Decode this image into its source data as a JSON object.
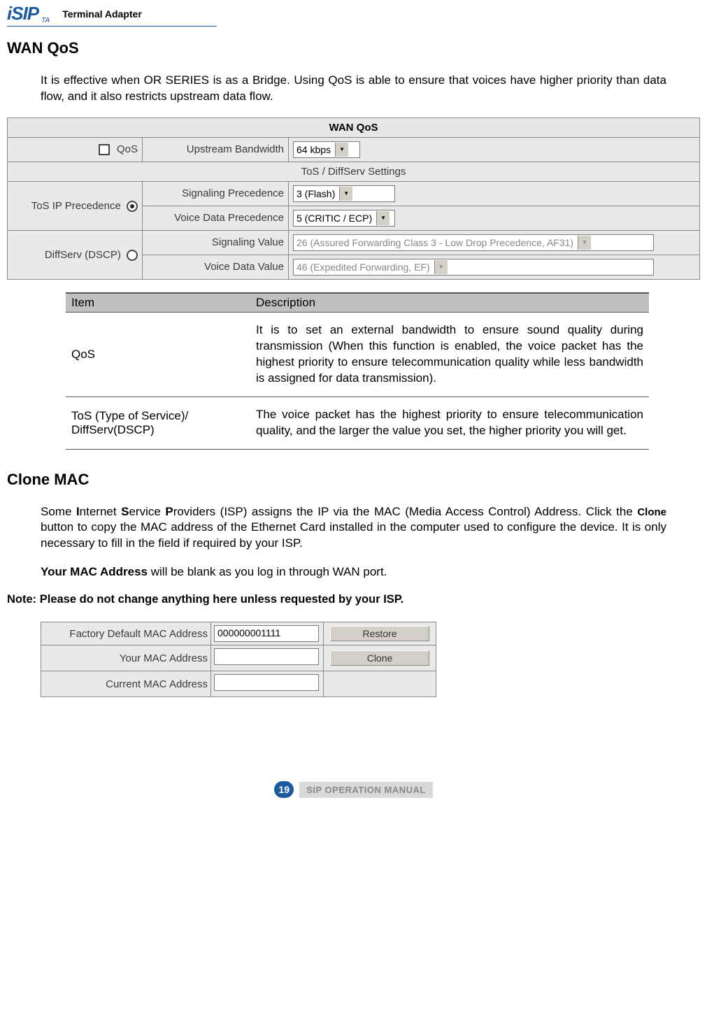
{
  "logo": {
    "ta": "TA",
    "product": "Terminal Adapter"
  },
  "sections": {
    "wan_qos": {
      "heading": "WAN QoS",
      "intro": "It is effective when OR SERIES is as a Bridge. Using QoS is able to ensure that voices have higher priority than data flow, and it also restricts upstream data flow."
    },
    "clone_mac": {
      "heading": "Clone MAC",
      "p1a": "Some ",
      "p1b": "nternet ",
      "p1c": "ervice ",
      "p1d": "roviders (ISP) assigns the IP via the MAC (Media Access Control) Address. Click the ",
      "p1e": " button to copy the MAC address of the Ethernet Card installed in the computer used to configure the device. It is only necessary to fill in the field if required by your ISP.",
      "p2a": "Your MAC Address",
      "p2b": " will be blank as you log in through WAN port.",
      "clone_word": "Clone",
      "i": "I",
      "s": "S",
      "p": "P"
    }
  },
  "wan_form": {
    "title": "WAN QoS",
    "qos_label": "QoS",
    "upstream_label": "Upstream Bandwidth",
    "upstream_value": "64 kbps",
    "tos_section": "ToS / DiffServ Settings",
    "tos_ip_label": "ToS IP Precedence",
    "diffserv_label": "DiffServ (DSCP)",
    "sig_prec_label": "Signaling Precedence",
    "sig_prec_value": "3 (Flash)",
    "voice_prec_label": "Voice Data Precedence",
    "voice_prec_value": "5 (CRITIC / ECP)",
    "sig_val_label": "Signaling Value",
    "sig_val_value": "26 (Assured Forwarding Class 3 - Low Drop Precedence, AF31)",
    "voice_val_label": "Voice Data Value",
    "voice_val_value": "46 (Expedited Forwarding, EF)"
  },
  "desc_table": {
    "col_item": "Item",
    "col_desc": "Description",
    "rows": [
      {
        "item": "QoS",
        "desc": "It is to set an external bandwidth to ensure sound quality during transmission (When this function is enabled, the voice packet has the highest priority to ensure telecommunication quality while less bandwidth is assigned for data transmission)."
      },
      {
        "item": "ToS (Type of Service)/ DiffServ(DSCP)",
        "desc": "The voice packet has the highest priority to ensure telecommunication quality, and the larger the value you set, the higher priority you will get."
      }
    ]
  },
  "note": "Note: Please do not change anything here unless requested by your ISP.",
  "mac_form": {
    "factory_label": "Factory Default MAC Address",
    "factory_value": "000000001111",
    "restore_btn": "Restore",
    "your_label": "Your MAC Address",
    "clone_btn": "Clone",
    "current_label": "Current MAC Address"
  },
  "footer": {
    "page": "19",
    "manual": "SIP OPERATION MANUAL"
  }
}
